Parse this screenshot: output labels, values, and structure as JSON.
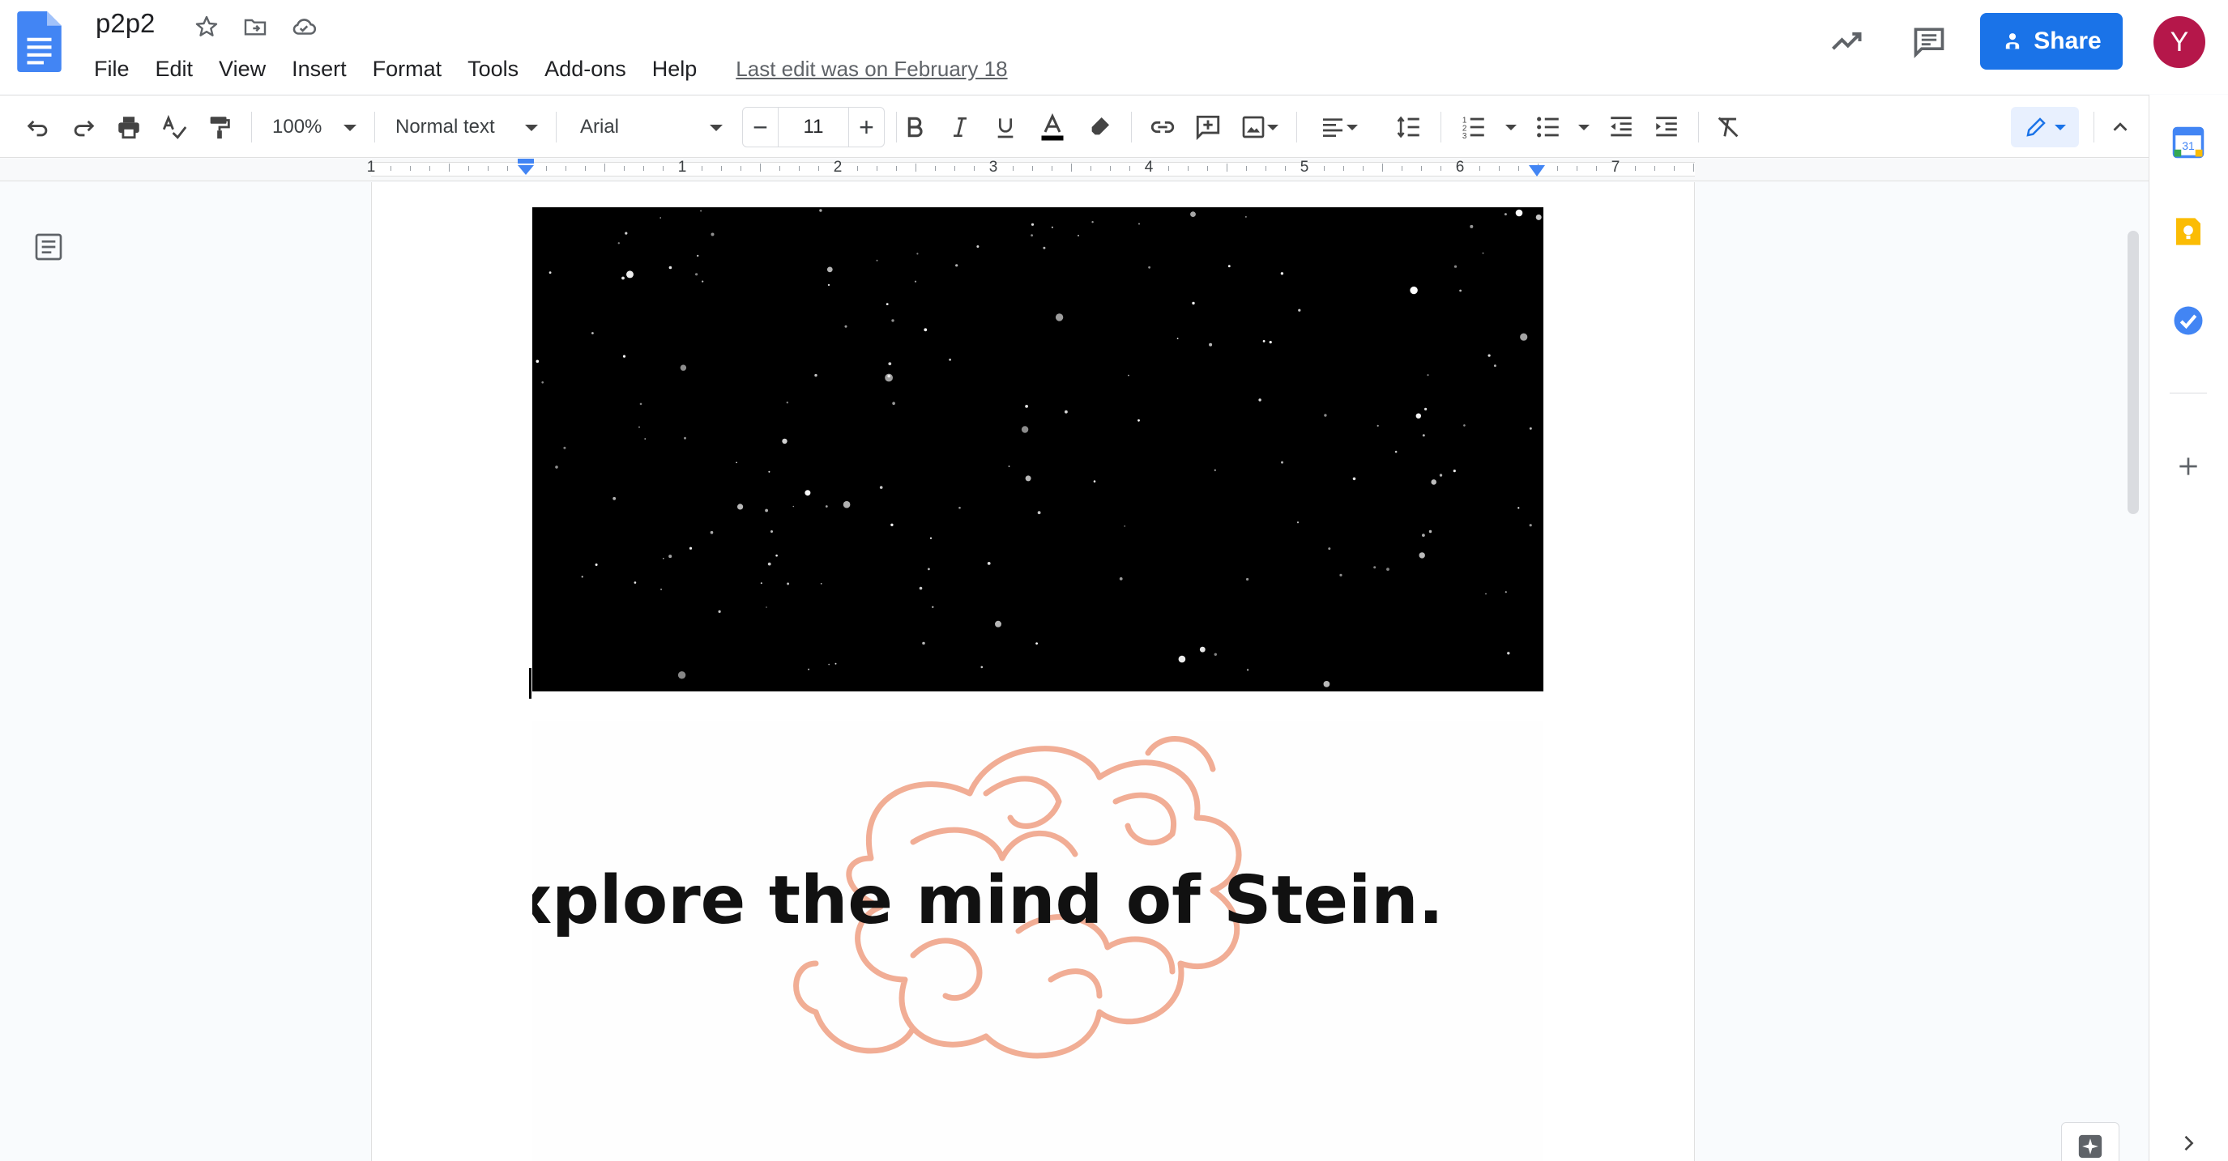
{
  "app": {
    "doc_title": "p2p2",
    "last_edit": "Last edit was on February 18"
  },
  "menu": [
    "File",
    "Edit",
    "View",
    "Insert",
    "Format",
    "Tools",
    "Add-ons",
    "Help"
  ],
  "header": {
    "share_label": "Share",
    "avatar_initial": "Y"
  },
  "toolbar": {
    "zoom": "100%",
    "style": "Normal text",
    "font": "Arial",
    "font_size": "11"
  },
  "ruler": {
    "labels": [
      "1",
      "1",
      "2",
      "3",
      "4",
      "5",
      "6",
      "7"
    ]
  },
  "side_panel": {
    "calendar_day": "31"
  },
  "document": {
    "cloud_text": "Explore the mind of Stein."
  },
  "colors": {
    "accent": "#1a73e8",
    "avatar": "#b5174a",
    "cloud": "#f0a58a",
    "keep": "#fbbc04",
    "tasks": "#4285f4"
  }
}
